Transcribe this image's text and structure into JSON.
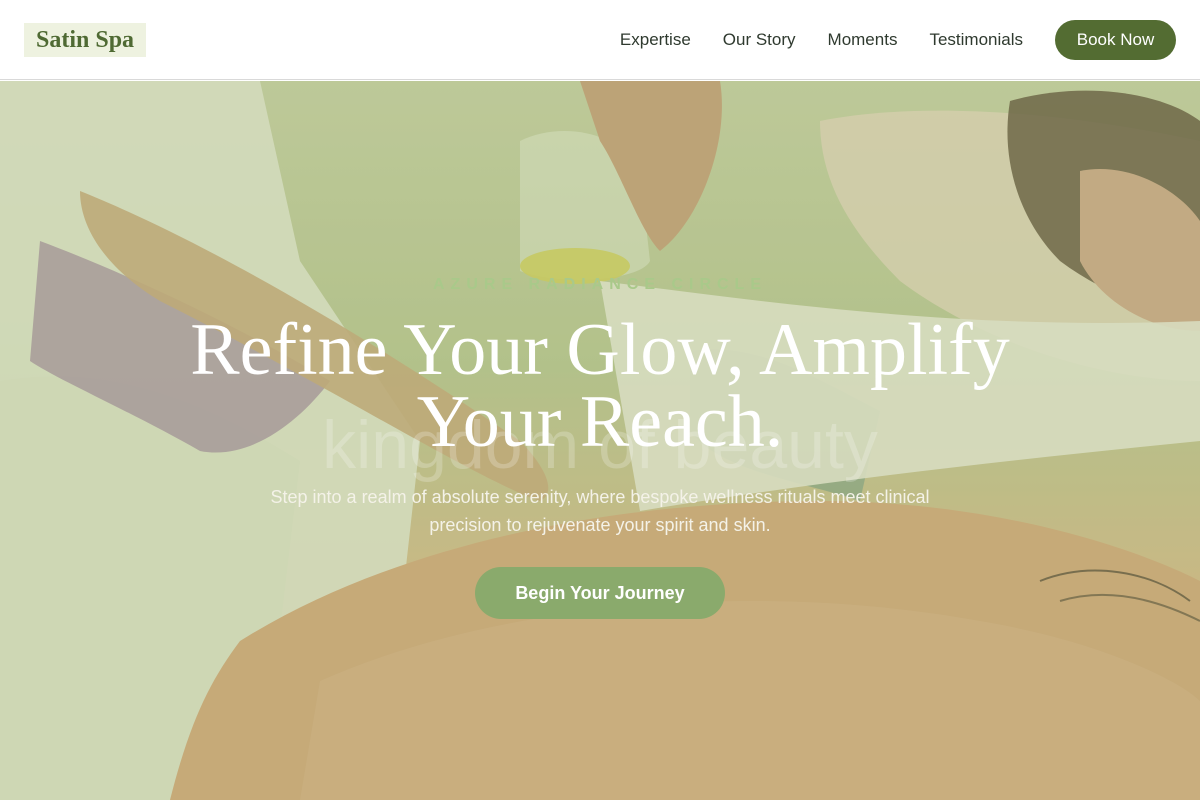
{
  "brand": {
    "name": "Satin Spa"
  },
  "nav": {
    "links": [
      "Expertise",
      "Our Story",
      "Moments",
      "Testimonials"
    ],
    "book_label": "Book Now"
  },
  "hero": {
    "eyebrow": "AZURE RADIANCE CIRCLE",
    "watermark": "kingdom of beauty",
    "headline": "Refine Your Glow, Amplify Your Reach.",
    "subtext": "Step into a realm of absolute serenity, where bespoke wellness rituals meet clinical precision to rejuvenate your spirit and skin.",
    "cta_label": "Begin Your Journey",
    "background_image": "spa-massage-oil-photo"
  },
  "colors": {
    "brand_green": "#536c32",
    "logo_text": "#4f6a33",
    "logo_bg": "#eef2e0",
    "cta_green": "#8aaa6c",
    "eyebrow_green": "#a9c98a"
  }
}
